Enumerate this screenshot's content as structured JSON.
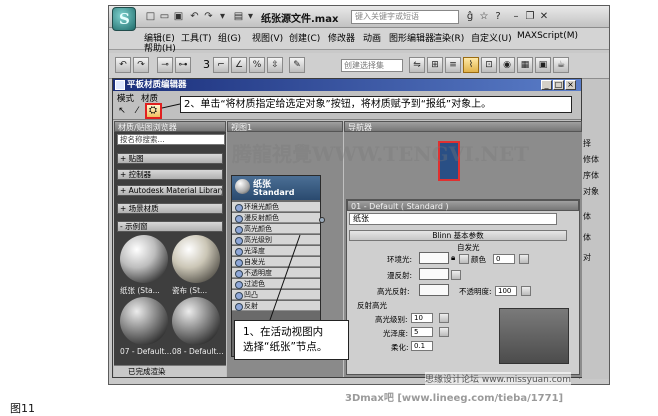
{
  "app": {
    "doc_title": "纸张源文件.max",
    "search_placeholder": "键入关键字或短语",
    "menus_row1": [
      "编辑(E)",
      "工具(T)",
      "组(G)",
      "视图(V)",
      "创建(C)",
      "修改器",
      "动画",
      "图形编辑器",
      "渲染(R)",
      "自定义(U)",
      "MAXScript(M)"
    ],
    "menus_row2": [
      "帮助(H)"
    ],
    "selection_set_placeholder": "创建选择集",
    "toolbar_number": "3",
    "right_panel_labels": [
      "择",
      "修体",
      "序体",
      "对象",
      "体",
      "体",
      "对"
    ]
  },
  "sme": {
    "title": "平板材质编辑器",
    "menu": [
      "模式",
      "材质"
    ],
    "browser": {
      "header": "材质/贴图浏览器",
      "search": "按名称搜索...",
      "categories": [
        "+ 贴图",
        "+ 控制器",
        "+ Autodesk Material Library",
        "+ 场景材质",
        "- 示例窗"
      ],
      "samples": [
        {
          "label": "纸张 (Sta..."
        },
        {
          "label": "瓷布 (St..."
        },
        {
          "label": "07 - Default..."
        },
        {
          "label": "08 - Default..."
        }
      ],
      "status": "已完成渲染"
    },
    "view": {
      "header": "视图1",
      "node_title": "纸张",
      "node_subtitle": "Standard",
      "slots": [
        "环境光颜色",
        "漫反射颜色",
        "高光颜色",
        "高光级别",
        "光泽度",
        "自发光",
        "不透明度",
        "过滤色",
        "凹凸",
        "反射"
      ]
    },
    "navigator": {
      "header": "导航器"
    },
    "params": {
      "title": "01 - Default ( Standard )",
      "name_field": "纸张",
      "rollout_blinn": "Blinn 基本参数",
      "self_illum": "自发光",
      "color_check": "颜色",
      "color_value": "0",
      "ambient": "环境光:",
      "diffuse": "漫反射:",
      "specular": "高光反射:",
      "opacity_label": "不透明度:",
      "opacity_value": "100",
      "group_highlight": "反射高光",
      "spec_level_label": "高光级别:",
      "spec_level_value": "10",
      "gloss_label": "光泽度:",
      "gloss_value": "5",
      "soften_label": "柔化:",
      "soften_value": "0.1"
    }
  },
  "callouts": {
    "step2": "2、单击“将材质指定给选定对象”按钮，将材质赋予到“报纸”对象上。",
    "step1_line1": "1、在活动视图内",
    "step1_line2": "选择“纸张”节点。"
  },
  "watermarks": {
    "center": "腾龍視覺WWW.TENGVI.NET",
    "bottom_right": "思缘设计论坛 www.missyuan.com",
    "footer": "3Dmax吧  [www.lineeg.com/tieba/1771]"
  },
  "figure_label": "图11",
  "colors": {
    "title_gradient_start": "#1a2e7a",
    "node_header": "#3c5f86",
    "highlight_red": "#e02020"
  }
}
